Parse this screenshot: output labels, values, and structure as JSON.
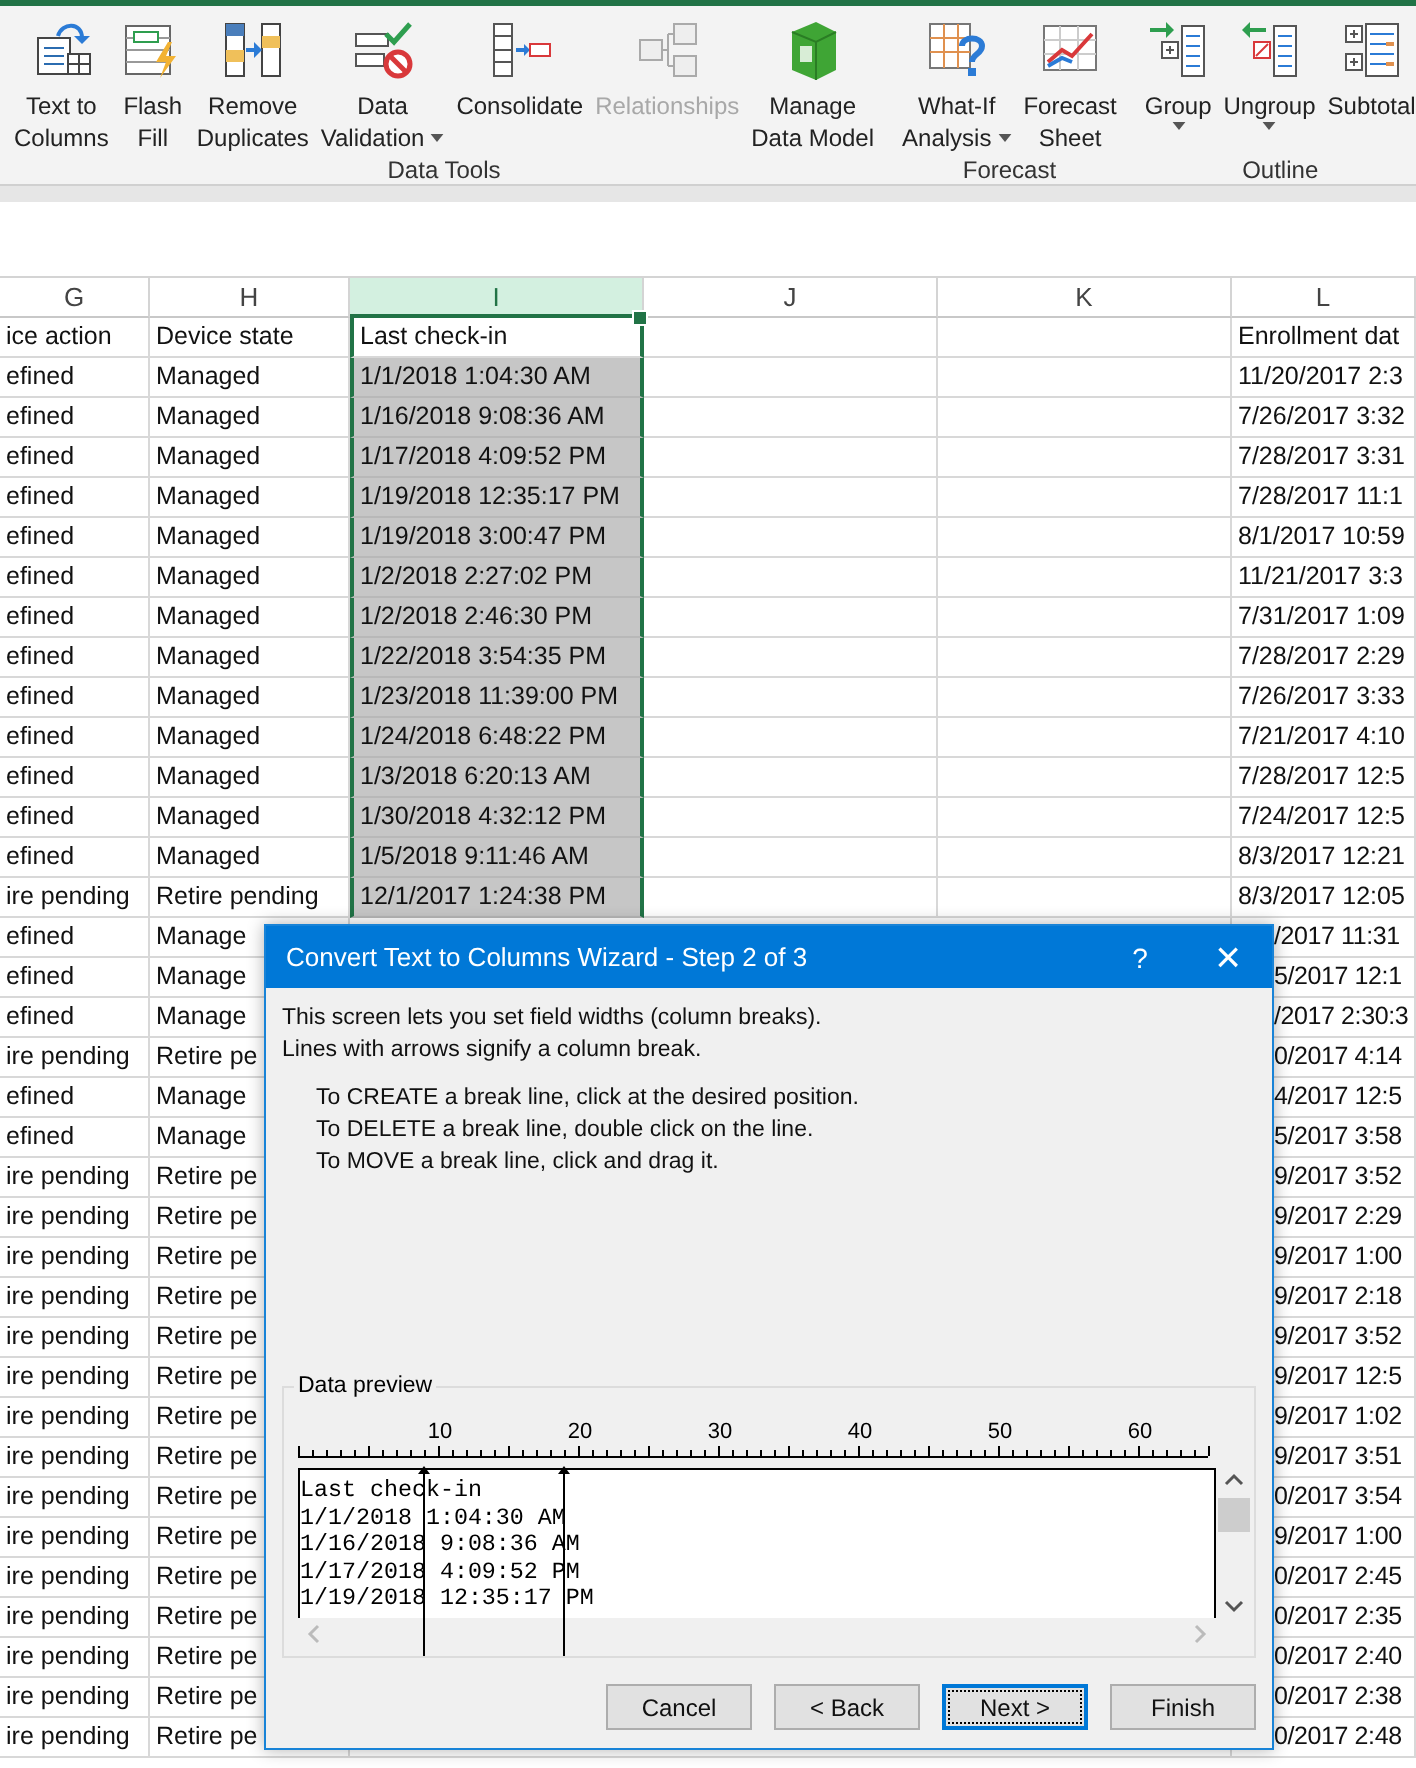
{
  "ribbon": {
    "groups": [
      {
        "label": "Data Tools",
        "buttons": [
          {
            "lines": [
              "Text to",
              "Columns"
            ],
            "dropdown": false,
            "disabled": false
          },
          {
            "lines": [
              "Flash",
              "Fill"
            ],
            "dropdown": false,
            "disabled": false
          },
          {
            "lines": [
              "Remove",
              "Duplicates"
            ],
            "dropdown": false,
            "disabled": false
          },
          {
            "lines": [
              "Data",
              "Validation"
            ],
            "dropdown": true,
            "disabled": false
          },
          {
            "lines": [
              "Consolidate"
            ],
            "dropdown": false,
            "disabled": false
          },
          {
            "lines": [
              "Relationships"
            ],
            "dropdown": false,
            "disabled": true
          },
          {
            "lines": [
              "Manage",
              "Data Model"
            ],
            "dropdown": false,
            "disabled": false
          }
        ]
      },
      {
        "label": "Forecast",
        "buttons": [
          {
            "lines": [
              "What-If",
              "Analysis"
            ],
            "dropdown": true,
            "disabled": false
          },
          {
            "lines": [
              "Forecast",
              "Sheet"
            ],
            "dropdown": false,
            "disabled": false
          }
        ]
      },
      {
        "label": "Outline",
        "buttons": [
          {
            "lines": [
              "Group"
            ],
            "dropdown": true,
            "disabled": false
          },
          {
            "lines": [
              "Ungroup"
            ],
            "dropdown": true,
            "disabled": false
          },
          {
            "lines": [
              "Subtotal"
            ],
            "dropdown": false,
            "disabled": false
          }
        ]
      }
    ]
  },
  "columns": [
    {
      "label": "G",
      "selected": false
    },
    {
      "label": "H",
      "selected": false
    },
    {
      "label": "I",
      "selected": true
    },
    {
      "label": "J",
      "selected": false
    },
    {
      "label": "K",
      "selected": false
    },
    {
      "label": "L",
      "selected": false
    }
  ],
  "rows": [
    {
      "g": "ice action",
      "h": "Device state",
      "i": "Last check-in",
      "active": true,
      "l": "Enrollment dat"
    },
    {
      "g": "efined",
      "h": "Managed",
      "i": "1/1/2018 1:04:30 AM",
      "active": false,
      "l": "11/20/2017 2:3"
    },
    {
      "g": "efined",
      "h": "Managed",
      "i": "1/16/2018 9:08:36 AM",
      "active": false,
      "l": "7/26/2017 3:32"
    },
    {
      "g": "efined",
      "h": "Managed",
      "i": "1/17/2018 4:09:52 PM",
      "active": false,
      "l": "7/28/2017 3:31"
    },
    {
      "g": "efined",
      "h": "Managed",
      "i": "1/19/2018 12:35:17 PM",
      "active": false,
      "l": "7/28/2017 11:1"
    },
    {
      "g": "efined",
      "h": "Managed",
      "i": "1/19/2018 3:00:47 PM",
      "active": false,
      "l": "8/1/2017 10:59"
    },
    {
      "g": "efined",
      "h": "Managed",
      "i": "1/2/2018 2:27:02 PM",
      "active": false,
      "l": "11/21/2017 3:3"
    },
    {
      "g": "efined",
      "h": "Managed",
      "i": "1/2/2018 2:46:30 PM",
      "active": false,
      "l": "7/31/2017 1:09"
    },
    {
      "g": "efined",
      "h": "Managed",
      "i": "1/22/2018 3:54:35 PM",
      "active": false,
      "l": "7/28/2017 2:29"
    },
    {
      "g": "efined",
      "h": "Managed",
      "i": "1/23/2018 11:39:00 PM",
      "active": false,
      "l": "7/26/2017 3:33"
    },
    {
      "g": "efined",
      "h": "Managed",
      "i": "1/24/2018 6:48:22 PM",
      "active": false,
      "l": "7/21/2017 4:10"
    },
    {
      "g": "efined",
      "h": "Managed",
      "i": "1/3/2018 6:20:13 AM",
      "active": false,
      "l": "7/28/2017 12:5"
    },
    {
      "g": "efined",
      "h": "Managed",
      "i": "1/30/2018 4:32:12 PM",
      "active": false,
      "l": "7/24/2017 12:5"
    },
    {
      "g": "efined",
      "h": "Managed",
      "i": "1/5/2018 9:11:46 AM",
      "active": false,
      "l": "8/3/2017 12:21"
    },
    {
      "g": "ire pending",
      "h": "Retire pending",
      "i": "12/1/2017 1:24:38 PM",
      "active": false,
      "l": "8/3/2017 12:05"
    },
    {
      "g": "efined",
      "h": "Manage",
      "l": "/2017 11:31"
    },
    {
      "g": "efined",
      "h": "Manage",
      "l": "5/2017 12:1"
    },
    {
      "g": "efined",
      "h": "Manage",
      "l": "/2017 2:30:3"
    },
    {
      "g": "ire pending",
      "h": "Retire pe",
      "l": "0/2017 4:14"
    },
    {
      "g": "efined",
      "h": "Manage",
      "l": "4/2017 12:5"
    },
    {
      "g": "efined",
      "h": "Manage",
      "l": "5/2017 3:58"
    },
    {
      "g": "ire pending",
      "h": "Retire pe",
      "l": "9/2017 3:52"
    },
    {
      "g": "ire pending",
      "h": "Retire pe",
      "l": "9/2017 2:29"
    },
    {
      "g": "ire pending",
      "h": "Retire pe",
      "l": "9/2017 1:00"
    },
    {
      "g": "ire pending",
      "h": "Retire pe",
      "l": "9/2017 2:18"
    },
    {
      "g": "ire pending",
      "h": "Retire pe",
      "l": "9/2017 3:52"
    },
    {
      "g": "ire pending",
      "h": "Retire pe",
      "l": "9/2017 12:5"
    },
    {
      "g": "ire pending",
      "h": "Retire pe",
      "l": "9/2017 1:02"
    },
    {
      "g": "ire pending",
      "h": "Retire pe",
      "l": "9/2017 3:51"
    },
    {
      "g": "ire pending",
      "h": "Retire pe",
      "l": "0/2017 3:54"
    },
    {
      "g": "ire pending",
      "h": "Retire pe",
      "l": "9/2017 1:00"
    },
    {
      "g": "ire pending",
      "h": "Retire pe",
      "l": "0/2017 2:45"
    },
    {
      "g": "ire pending",
      "h": "Retire pe",
      "l": "0/2017 2:35"
    },
    {
      "g": "ire pending",
      "h": "Retire pe",
      "l": "0/2017 2:40"
    },
    {
      "g": "ire pending",
      "h": "Retire pe",
      "l": "0/2017 2:38"
    },
    {
      "g": "ire pending",
      "h": "Retire pe",
      "l": "0/2017 2:48"
    }
  ],
  "dialog": {
    "title": "Convert Text to Columns Wizard - Step 2 of 3",
    "help": "?",
    "close": "×",
    "intro": [
      "This screen lets you set field widths (column breaks).",
      "Lines with arrows signify a column break."
    ],
    "instructions": [
      "To CREATE a break line, click at the desired position.",
      "To DELETE a break line, double click on the line.",
      "To MOVE a break line, click and drag it."
    ],
    "preview": {
      "label": "Data preview",
      "ruler_labels": [
        "10",
        "20",
        "30",
        "40",
        "50",
        "60"
      ],
      "breaks": [
        {
          "level": 0.138
        },
        {
          "level": 0.292
        }
      ],
      "lines": [
        "Last check-in",
        "1/1/2018 1:04:30 AM",
        "1/16/2018 9:08:36 AM",
        "1/17/2018 4:09:52 PM",
        "1/19/2018 12:35:17 PM"
      ]
    },
    "buttons": [
      {
        "label": "Cancel",
        "focused": false
      },
      {
        "label": "< Back",
        "focused": false
      },
      {
        "label": "Next >",
        "focused": true
      },
      {
        "label": "Finish",
        "focused": false
      }
    ]
  }
}
